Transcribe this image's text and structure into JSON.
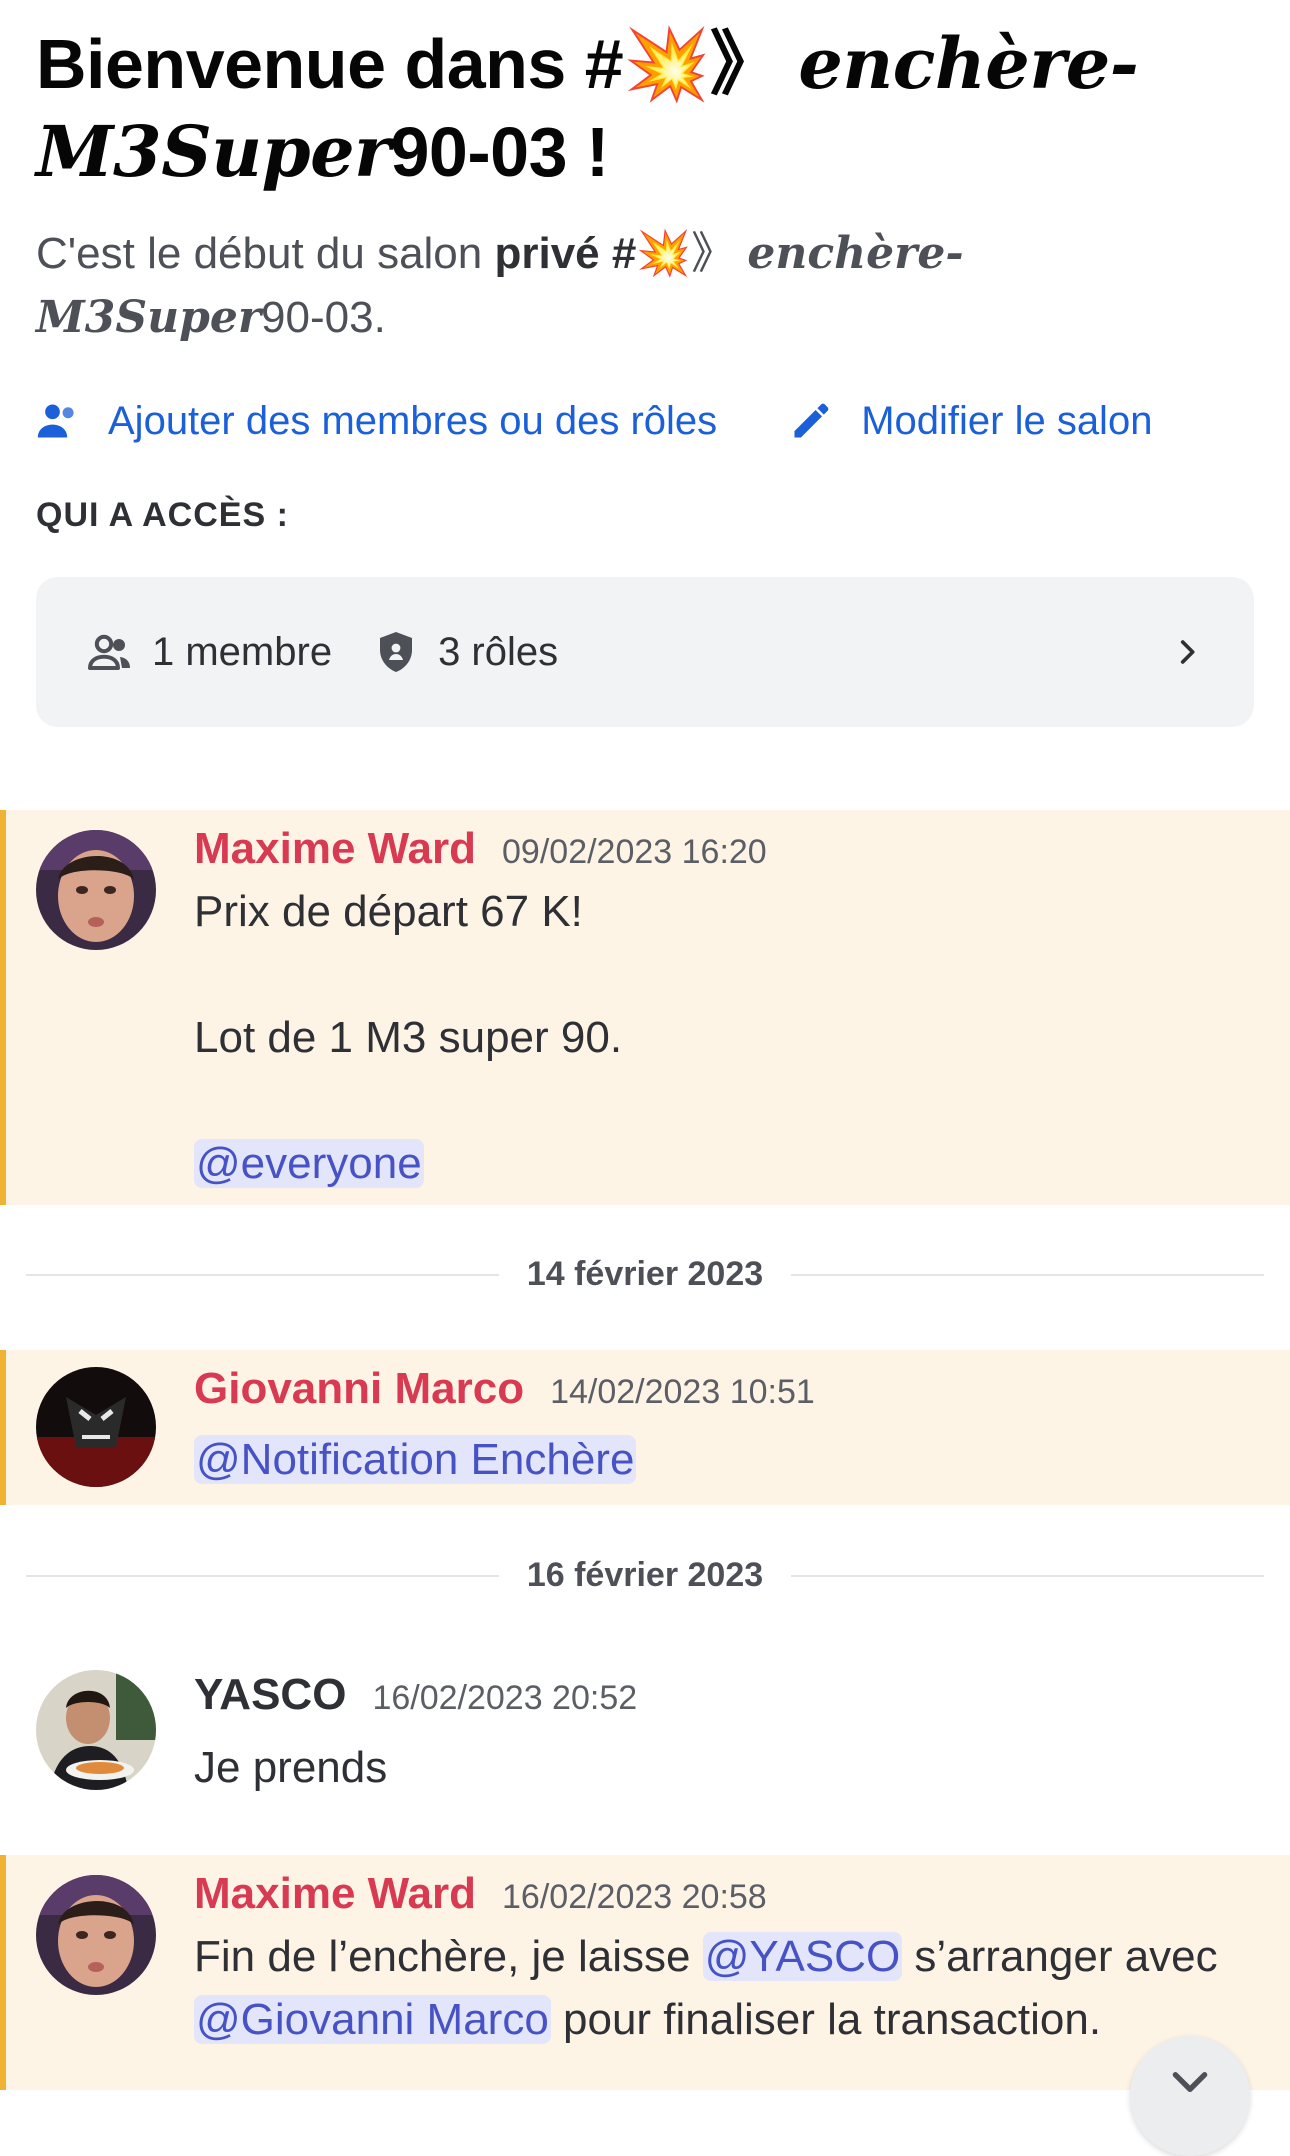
{
  "header": {
    "title_prefix": "Bienvenue dans #",
    "title_icon": "💥",
    "title_arrow": "》",
    "title_script_1": "enchère-",
    "title_script_2": "M3Super",
    "title_suffix": "90-03 !",
    "intro_prefix": "C'est le début du salon ",
    "intro_bold": "privé #",
    "intro_icon": "💥",
    "intro_arrow": "》",
    "intro_script_1": "enchère-",
    "intro_script_2": "M3Super",
    "intro_suffix": "90-03."
  },
  "actions": {
    "add_members": "Ajouter des membres ou des rôles",
    "edit_channel": "Modifier le salon"
  },
  "access": {
    "label": "QUI A ACCÈS :",
    "members": "1 membre",
    "roles": "3 rôles"
  },
  "messages": [
    {
      "author": "Maxime Ward",
      "timestamp": "09/02/2023 16:20",
      "line1": "Prix de départ 67 K!",
      "line2": "Lot de 1 M3 super 90.",
      "mention": "@everyone"
    },
    {
      "author": "Giovanni Marco",
      "timestamp": "14/02/2023 10:51",
      "mention": "@Notification Enchère"
    },
    {
      "author": "YASCO",
      "timestamp": "16/02/2023 20:52",
      "text": "Je prends"
    },
    {
      "author": "Maxime Ward",
      "timestamp": "16/02/2023 20:58",
      "text_a": "Fin de l’enchère, je laisse ",
      "mention_a": "@YASCO",
      "text_b": " s’arranger avec",
      "mention_b": "@Giovanni Marco",
      "text_c": " pour finaliser la transaction."
    }
  ],
  "dividers": [
    "14 février 2023",
    "16 février 2023"
  ],
  "colors": {
    "link_blue": "#1b5fd9",
    "author_red": "#d83a52",
    "highlight_bg": "#fdf4e6",
    "highlight_bar": "#f0b232",
    "mention_bg": "#e3e6fb",
    "mention_text": "#4752c4"
  },
  "icons": {
    "add_members": "person-add-icon",
    "edit_channel": "pencil-icon",
    "members": "people-icon",
    "roles": "shield-icon",
    "chevron": "chevron-right-icon",
    "scroll": "chevron-down-icon"
  }
}
